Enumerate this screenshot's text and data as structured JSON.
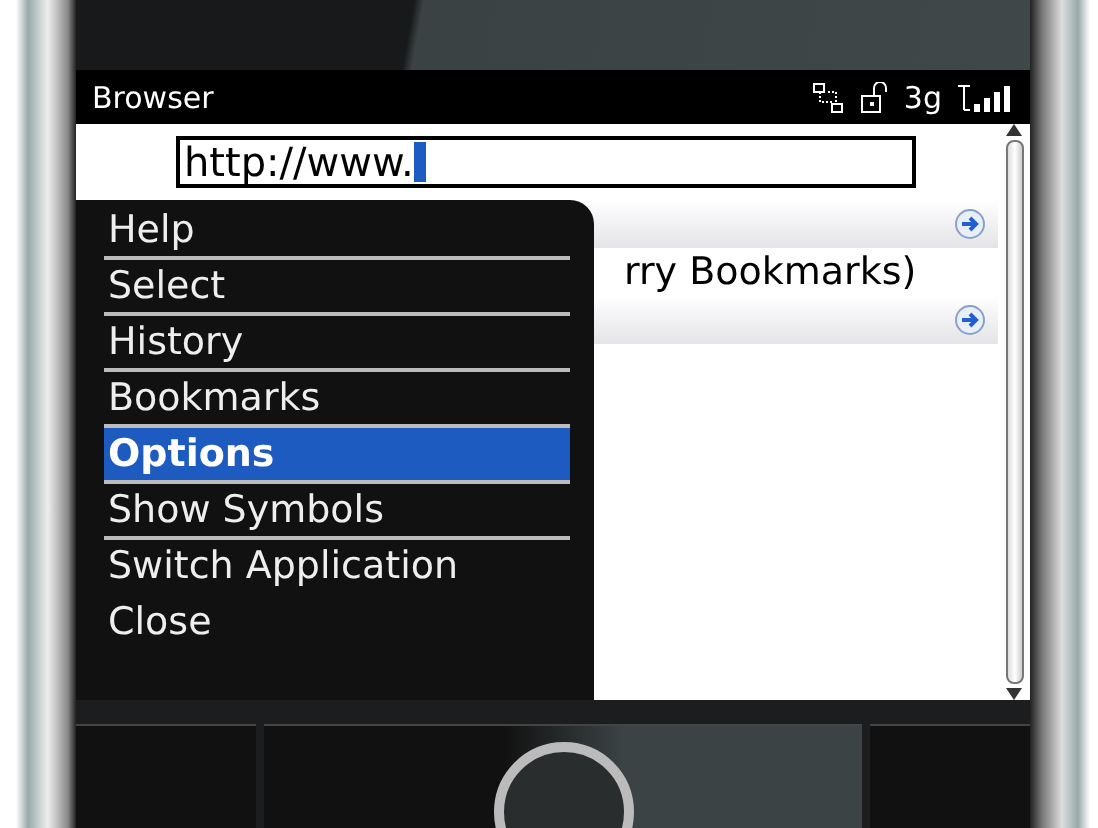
{
  "status_bar": {
    "title": "Browser",
    "network": "3g"
  },
  "address_field": {
    "value": "http://www."
  },
  "rows": [
    {
      "kind": "heading"
    },
    {
      "kind": "entry",
      "text": "rry Bookmarks)"
    },
    {
      "kind": "heading"
    }
  ],
  "menu": [
    {
      "label": "Help",
      "selected": false,
      "divider": true
    },
    {
      "label": "Select",
      "selected": false,
      "divider": true
    },
    {
      "label": "History",
      "selected": false,
      "divider": true
    },
    {
      "label": "Bookmarks",
      "selected": false,
      "divider": true
    },
    {
      "label": "Options",
      "selected": true,
      "divider": true
    },
    {
      "label": "Show Symbols",
      "selected": false,
      "divider": true
    },
    {
      "label": "Switch Application",
      "selected": false,
      "divider": false
    },
    {
      "label": "Close",
      "selected": false,
      "divider": false
    }
  ]
}
